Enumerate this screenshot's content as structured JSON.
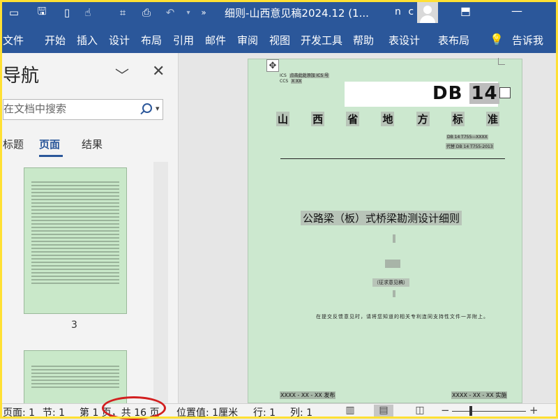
{
  "titlebar": {
    "title": "细则-山西意见稿2024.12 (1...",
    "user": "n c"
  },
  "ribbon": {
    "tabs": [
      "文件",
      "开始",
      "插入",
      "设计",
      "布局",
      "引用",
      "邮件",
      "审阅",
      "视图",
      "开发工具",
      "帮助",
      "表设计",
      "表布局"
    ],
    "tell_me": "告诉我"
  },
  "nav": {
    "title": "导航",
    "search_placeholder": "在文档中搜索",
    "tabs": [
      "标题",
      "页面",
      "结果"
    ],
    "active_tab": "页面",
    "thumb_page_number": "3"
  },
  "document": {
    "ics_label": "ICS",
    "ics_value": "点击此处添加 ICS 号",
    "ccs_label": "CCS",
    "ccs_value": "X XX",
    "db_prefix": "DB",
    "db_number": "14",
    "standard_title": [
      "山",
      "西",
      "省",
      "地",
      "方",
      "标",
      "准"
    ],
    "code_line1": "DB 14  T755—XXXX",
    "code_line2": "代替 DB 14  T755-2013",
    "main_title": "公路梁（板）式桥梁勘测设计细则",
    "draft_label": "（征求意见稿）",
    "note": "在提交反馈意见时，请将您知道的相关专利连同支持性文件一并附上。",
    "publish": "XXXX - XX - XX 发布",
    "implement": "XXXX - XX - XX 实施"
  },
  "status": {
    "page_label": "页面: 1",
    "section": "节: 1",
    "page_count": "第 1 页，共 16 页",
    "position": "位置值: 1厘米",
    "row": "行: 1",
    "col": "列: 1"
  },
  "colors": {
    "brand": "#2b579a",
    "page_bg": "#cce8cf",
    "highlight_ring": "#d21f1f"
  }
}
